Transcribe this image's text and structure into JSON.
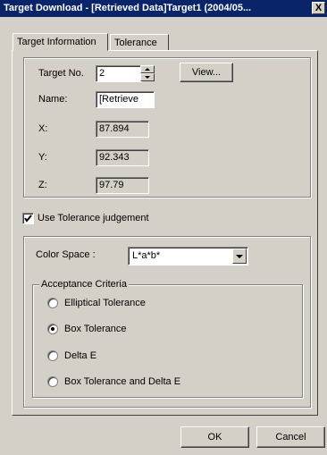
{
  "window": {
    "title": "Target Download - [Retrieved Data]Target1 (2004/05...",
    "close_label": "X"
  },
  "tabs": [
    {
      "label": "Target Information"
    },
    {
      "label": "Tolerance"
    }
  ],
  "target_info": {
    "target_no_label": "Target No.",
    "target_no_value": "2",
    "view_button": "View...",
    "name_label": "Name:",
    "name_value": "[Retrieve",
    "x_label": "X:",
    "x_value": "87.894",
    "y_label": "Y:",
    "y_value": "92.343",
    "z_label": "Z:",
    "z_value": "97.79"
  },
  "tolerance": {
    "use_label": "Use Tolerance judgement",
    "use_checked": true,
    "color_space_label": "Color Space :",
    "color_space_value": "L*a*b*",
    "criteria_title": "Acceptance Criteria",
    "options": [
      {
        "label": "Elliptical Tolerance",
        "selected": false
      },
      {
        "label": "Box Tolerance",
        "selected": true
      },
      {
        "label": "Delta E",
        "selected": false
      },
      {
        "label": "Box Tolerance and Delta E",
        "selected": false
      }
    ]
  },
  "buttons": {
    "ok": "OK",
    "cancel": "Cancel"
  }
}
